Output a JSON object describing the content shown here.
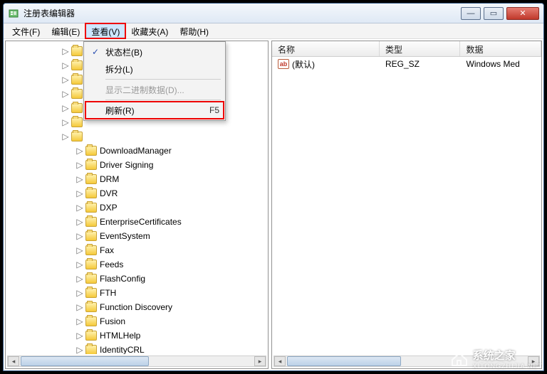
{
  "window": {
    "title": "注册表编辑器"
  },
  "menu": {
    "file": "文件(F)",
    "edit": "编辑(E)",
    "view": "查看(V)",
    "favorites": "收藏夹(A)",
    "help": "帮助(H)"
  },
  "view_menu": {
    "status_bar": "状态栏(B)",
    "split": "拆分(L)",
    "display_binary": "显示二进制数据(D)...",
    "refresh": "刷新(R)",
    "refresh_shortcut": "F5"
  },
  "tree": {
    "items": [
      {
        "indent": 72,
        "label": ""
      },
      {
        "indent": 72,
        "label": ""
      },
      {
        "indent": 72,
        "label": ""
      },
      {
        "indent": 72,
        "label": ""
      },
      {
        "indent": 72,
        "label": ""
      },
      {
        "indent": 72,
        "label": ""
      },
      {
        "indent": 72,
        "label": ""
      },
      {
        "indent": 92,
        "label": "DownloadManager"
      },
      {
        "indent": 92,
        "label": "Driver Signing"
      },
      {
        "indent": 92,
        "label": "DRM"
      },
      {
        "indent": 92,
        "label": "DVR"
      },
      {
        "indent": 92,
        "label": "DXP"
      },
      {
        "indent": 92,
        "label": "EnterpriseCertificates"
      },
      {
        "indent": 92,
        "label": "EventSystem"
      },
      {
        "indent": 92,
        "label": "Fax"
      },
      {
        "indent": 92,
        "label": "Feeds"
      },
      {
        "indent": 92,
        "label": "FlashConfig"
      },
      {
        "indent": 92,
        "label": "FTH"
      },
      {
        "indent": 92,
        "label": "Function Discovery"
      },
      {
        "indent": 92,
        "label": "Fusion"
      },
      {
        "indent": 92,
        "label": "HTMLHelp"
      },
      {
        "indent": 92,
        "label": "IdentityCRL"
      }
    ]
  },
  "list": {
    "columns": {
      "name": "名称",
      "type": "类型",
      "data": "数据"
    },
    "col_widths": {
      "name": 160,
      "type": 120,
      "data": 120
    },
    "rows": [
      {
        "name": "(默认)",
        "type": "REG_SZ",
        "data": "Windows Med"
      }
    ]
  },
  "watermark": {
    "main": "系统之家",
    "sub": "XITONGZHIJIA.NET"
  }
}
